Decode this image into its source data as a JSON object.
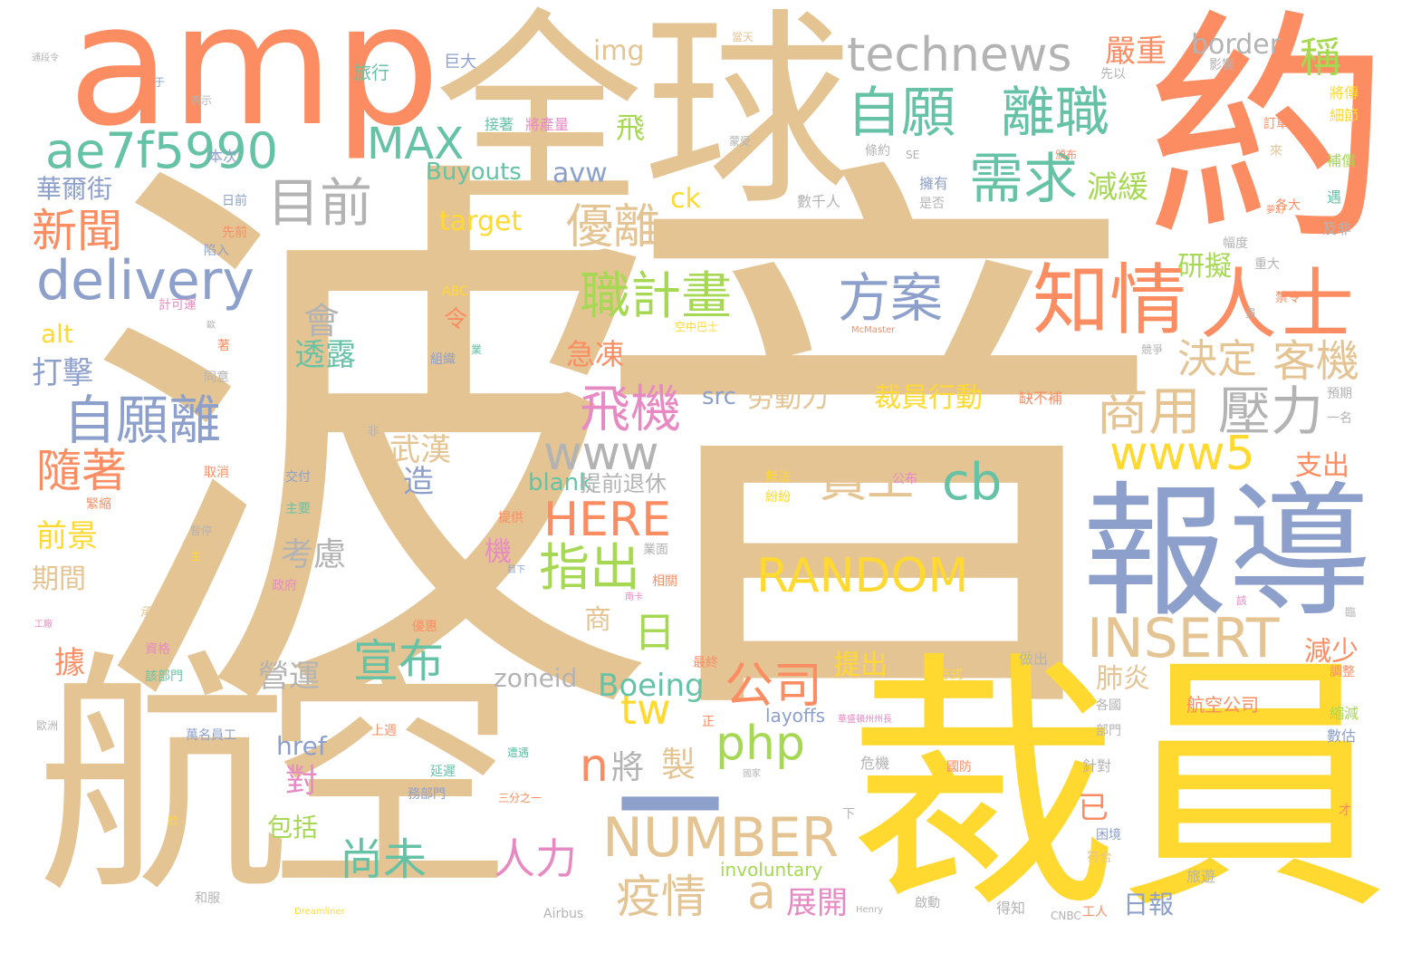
{
  "words": {
    "w01": "波音",
    "w02": "裁員",
    "w03": "全球",
    "w04": "約",
    "w05": "amp",
    "w06": "報導",
    "w07": "航空",
    "w08": "technews",
    "w09": "自願",
    "w10": "離職",
    "w11": "ae7f5990",
    "w12": "知情",
    "w13": "人士",
    "w14": "delivery",
    "w15": "RANDOM",
    "w16": "NUMBER",
    "w17": "INSERT",
    "w18": "www",
    "w19": "www5",
    "w20": "需求",
    "w21": "目前",
    "w22": "MAX",
    "w23": "新聞",
    "w24": "職計畫",
    "w25": "方案",
    "w26": "自願離",
    "w27": "決定",
    "w28": "客機",
    "w29": "商用",
    "w30": "壓力",
    "w31": "飛機",
    "w32": "HERE",
    "w33": "cb",
    "w34": "員工",
    "w35": "指出",
    "w36": "php",
    "w37": "公司",
    "w38": "優離",
    "w39": "隨著",
    "w40": "宣布",
    "w41": "疫情",
    "w42": "尚未",
    "w43": "人力",
    "w44": "tw",
    "w45": "Boeing",
    "w46": "zoneid",
    "w47": "嚴重",
    "w48": "border",
    "w49": "稱",
    "w50": "img",
    "w51": "減緩",
    "w52": "研擬",
    "w53": "會",
    "w54": "透露",
    "w55": "急凍",
    "w56": "打擊",
    "w57": "裁員行動",
    "w58": "勞動力",
    "w59": "src",
    "w60": "avw",
    "w61": "ck",
    "w62": "target",
    "w63": "華爾街",
    "w64": "Buyouts",
    "w65": "alt",
    "w66": "武漢",
    "w67": "造",
    "w68": "blank",
    "w69": "提前退休",
    "w70": "前景",
    "w71": "考慮",
    "w72": "期間",
    "w73": "機",
    "w74": "據",
    "w75": "營運",
    "w76": "對",
    "w77": "包括",
    "w78": "href",
    "w79": "製",
    "w80": "將",
    "w81": "n",
    "w82": "a",
    "w83": "展開",
    "w84": "日報",
    "w85": "日",
    "w86": "肺炎",
    "w87": "減少",
    "w88": "支出",
    "w89": "提出",
    "w90": "航空公司",
    "w91": "layoffs",
    "w92": "involuntary",
    "w93": "已",
    "w94": "令",
    "w95": "商",
    "w96": "飛",
    "w97": "旅行",
    "w98": "巨大",
    "w99": "接著",
    "w100": "將產量",
    "w101": "預計",
    "w102": "本次",
    "w103": "日前",
    "w104": "先前",
    "w105": "陷入",
    "w106": "計可運",
    "w107": "ABC",
    "w108": "組織",
    "w109": "同意",
    "w110": "缺不補",
    "w111": "交付",
    "w112": "主要",
    "w113": "緊縮",
    "w114": "取消",
    "w115": "非",
    "w116": "暫停",
    "w117": "提供",
    "w118": "業面",
    "w119": "相關",
    "w120": "政府",
    "w121": "承受",
    "w122": "資格",
    "w123": "優惠",
    "w124": "該部門",
    "w125": "萬名員工",
    "w126": "上週",
    "w127": "遭遇",
    "w128": "最終",
    "w129": "延遲",
    "w130": "務部門",
    "w131": "三分之一",
    "w132": "危機",
    "w133": "國防",
    "w134": "方式",
    "w135": "做出",
    "w136": "各國",
    "w137": "部門",
    "w138": "針對",
    "w139": "困境",
    "w140": "符合",
    "w141": "旅遊",
    "w142": "工人",
    "w143": "得知",
    "w144": "啟動",
    "w145": "CNBC",
    "w146": "Airbus",
    "w147": "Dreamliner",
    "w148": "Henry",
    "w149": "和服",
    "w150": "無法",
    "w151": "紛紛",
    "w152": "公布",
    "w153": "空中巴士",
    "w154": "McMaster",
    "w155": "蒙受",
    "w156": "擁有",
    "w157": "是否",
    "w158": "數千人",
    "w159": "頒布",
    "w160": "影響",
    "w161": "先以",
    "w162": "SE",
    "w163": "條約",
    "w164": "訂單",
    "w165": "來",
    "w166": "將傳",
    "w167": "細節",
    "w168": "補償",
    "w169": "遇",
    "w170": "各大",
    "w171": "及非",
    "w172": "幅度",
    "w173": "重大",
    "w174": "禁令",
    "w175": "預期",
    "w176": "一名",
    "w177": "調整",
    "w178": "縮減",
    "w179": "數估",
    "w180": "員",
    "w181": "競爭",
    "w182": "臨",
    "w183": "該",
    "w184": "才",
    "w185": "華盛頓州州長",
    "w186": "正",
    "w187": "國家",
    "w188": "下",
    "w189": "於",
    "w190": "南卡",
    "w191": "目下",
    "w192": "著",
    "w193": "業",
    "w194": "歐",
    "w195": "表示",
    "w196": "于",
    "w197": "通段令",
    "w198": "當天",
    "w199": "工廠",
    "w200": "歐洲",
    "w201": "夢幻",
    "w202": "主",
    "w203": "—"
  },
  "colors": {
    "tan": "#e5c494",
    "orange": "#fc8d62",
    "blue": "#8da0cb",
    "yellow": "#ffd92f",
    "green": "#66c2a5",
    "lime": "#a6d854",
    "pink": "#e78ac3",
    "gray": "#b3b3b3"
  }
}
